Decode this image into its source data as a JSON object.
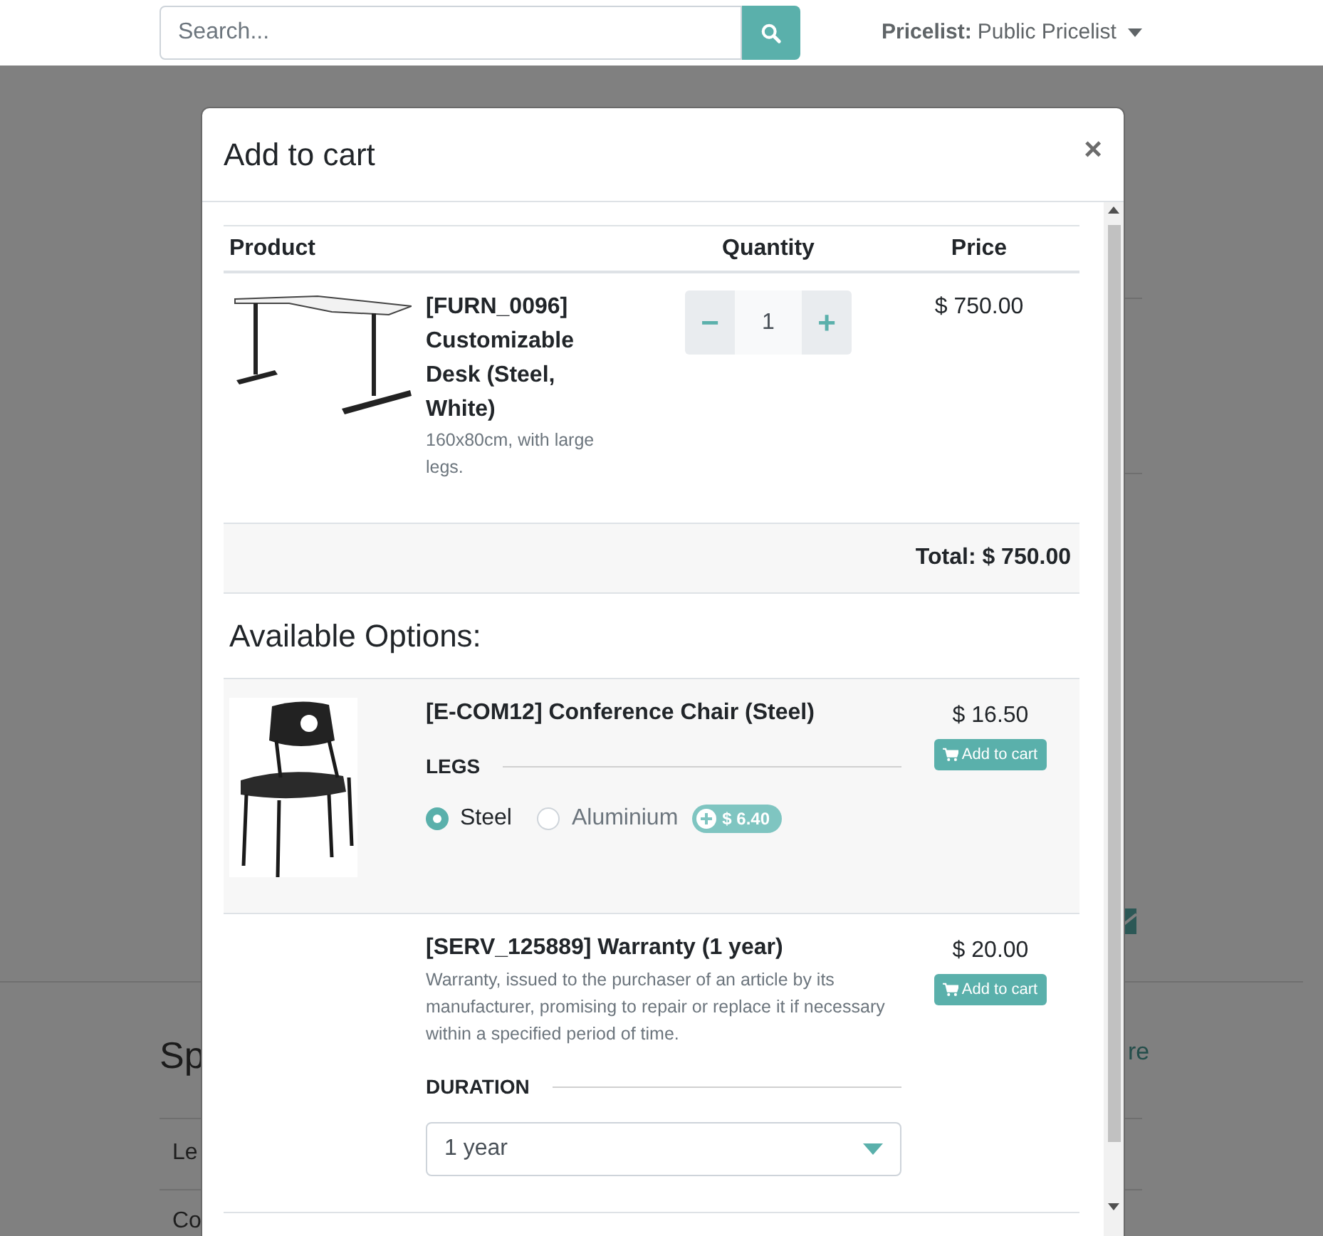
{
  "header": {
    "search": {
      "placeholder": "Search..."
    },
    "pricelist": {
      "label": "Pricelist:",
      "value": "Public Pricelist"
    }
  },
  "background_fragments": [
    {
      "text": "Sp",
      "kind": "heading"
    },
    {
      "text": "re",
      "kind": "link"
    },
    {
      "text": "Le",
      "kind": "row"
    },
    {
      "text": "Co",
      "kind": "row"
    }
  ],
  "modal": {
    "title": "Add to cart",
    "close": "×",
    "table": {
      "columns": [
        "Product",
        "Quantity",
        "Price"
      ],
      "product": {
        "name": "[FURN_0096] Customizable Desk (Steel, White)",
        "description": "160x80cm, with large legs.",
        "quantity": "1",
        "minus": "−",
        "plus": "+",
        "price": "$ 750.00"
      },
      "total": "Total: $ 750.00"
    },
    "options_title": "Available Options:",
    "options": [
      {
        "name": "[E-COM12] Conference Chair (Steel)",
        "price": "$ 16.50",
        "button": "Add to cart",
        "attribute": {
          "name": "LEGS",
          "kind": "radio",
          "values": [
            {
              "label": "Steel",
              "selected": true
            },
            {
              "label": "Aluminium",
              "selected": false,
              "extra": "$ 6.40"
            }
          ]
        }
      },
      {
        "name": "[SERV_125889] Warranty (1 year)",
        "description": "Warranty, issued to the purchaser of an article by its manufacturer, promising to repair or replace it if necessary within a specified period of time.",
        "price": "$ 20.00",
        "button": "Add to cart",
        "attribute": {
          "name": "DURATION",
          "kind": "select",
          "value": "1 year"
        }
      }
    ]
  }
}
